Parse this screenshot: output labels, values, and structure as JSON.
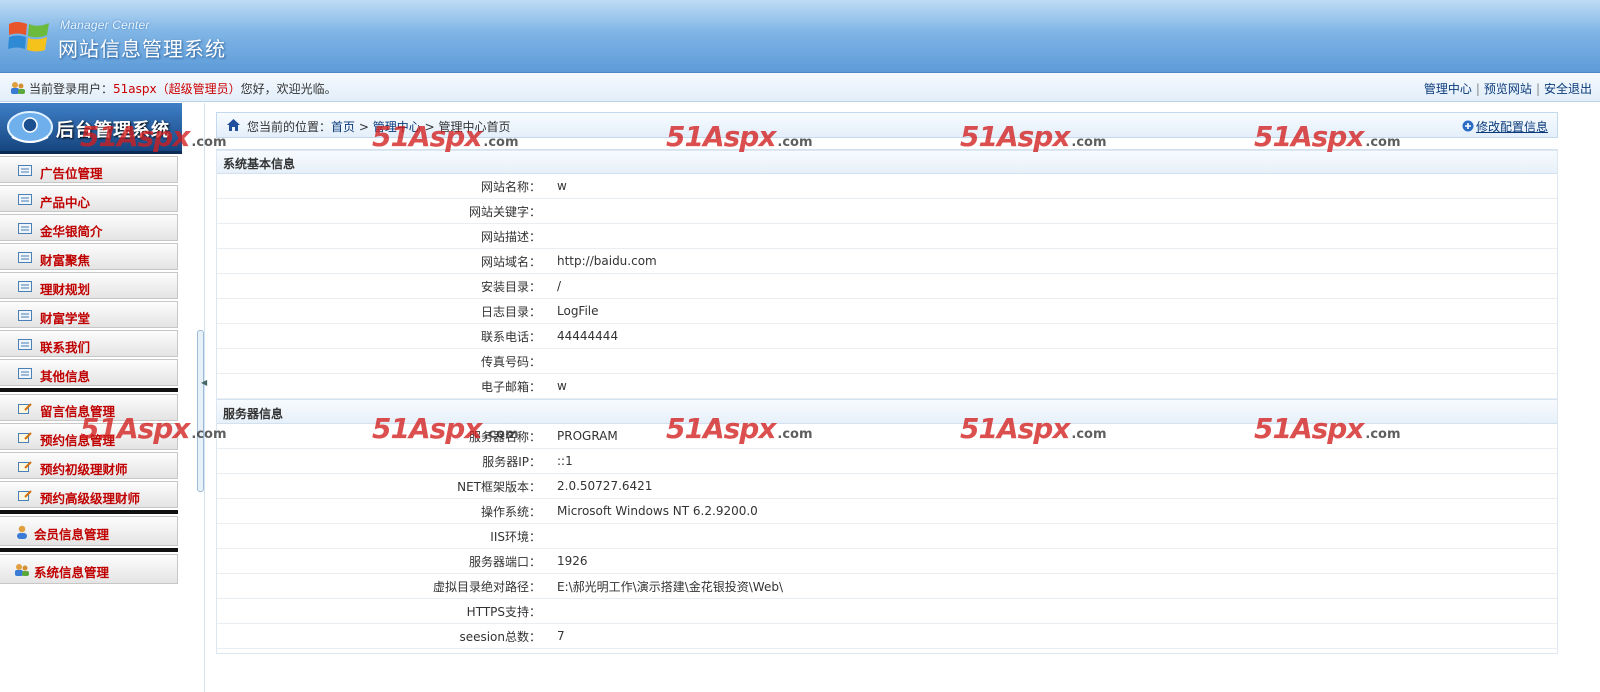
{
  "header": {
    "subtitle": "Manager Center",
    "title": "网站信息管理系统"
  },
  "userbar": {
    "prefix": "当前登录用户：",
    "username": "51aspx（超级管理员）",
    "greeting": "您好，欢迎光临。",
    "links": [
      "管理中心",
      "预览网站",
      "安全退出"
    ],
    "separator": "|"
  },
  "sidebar": {
    "heading": "后台管理系统",
    "group1": [
      "广告位管理",
      "产品中心",
      "金华银简介",
      "财富聚焦",
      "理财规划",
      "财富学堂",
      "联系我们",
      "其他信息"
    ],
    "group2": [
      "留言信息管理",
      "预约信息管理",
      "预约初级理财师",
      "预约高级级理财师"
    ],
    "member": "会员信息管理",
    "system": "系统信息管理"
  },
  "breadcrumb": {
    "prefix": "您当前的位置：",
    "items": [
      "首页",
      "管理中心",
      "管理中心首页"
    ],
    "separator": ">",
    "edit_link": "修改配置信息"
  },
  "site_info": {
    "heading": "系统基本信息",
    "rows": [
      {
        "k": "网站名称：",
        "v": "w"
      },
      {
        "k": "网站关键字：",
        "v": ""
      },
      {
        "k": "网站描述：",
        "v": ""
      },
      {
        "k": "网站域名：",
        "v": "http://baidu.com"
      },
      {
        "k": "安装目录：",
        "v": "/"
      },
      {
        "k": "日志目录：",
        "v": "LogFile"
      },
      {
        "k": "联系电话：",
        "v": "44444444"
      },
      {
        "k": "传真号码：",
        "v": ""
      },
      {
        "k": "电子邮箱：",
        "v": "w"
      }
    ]
  },
  "server_info": {
    "heading": "服务器信息",
    "rows": [
      {
        "k": "服务器名称：",
        "v": "PROGRAM"
      },
      {
        "k": "服务器IP：",
        "v": "::1"
      },
      {
        "k": "NET框架版本：",
        "v": "2.0.50727.6421"
      },
      {
        "k": "操作系统：",
        "v": "Microsoft Windows NT 6.2.9200.0"
      },
      {
        "k": "IIS环境：",
        "v": ""
      },
      {
        "k": "服务器端口：",
        "v": "1926"
      },
      {
        "k": "虚拟目录绝对路径：",
        "v": "E:\\郝光明工作\\演示搭建\\金花银投资\\Web\\"
      },
      {
        "k": "HTTPS支持：",
        "v": ""
      },
      {
        "k": "seesion总数：",
        "v": "7"
      }
    ]
  },
  "watermark": {
    "brand": "51Aspx",
    "suffix": ".com"
  },
  "colors": {
    "accent": "#0b3a7a",
    "menu_text": "#c00000",
    "header_blue": "#5d9bd8"
  }
}
